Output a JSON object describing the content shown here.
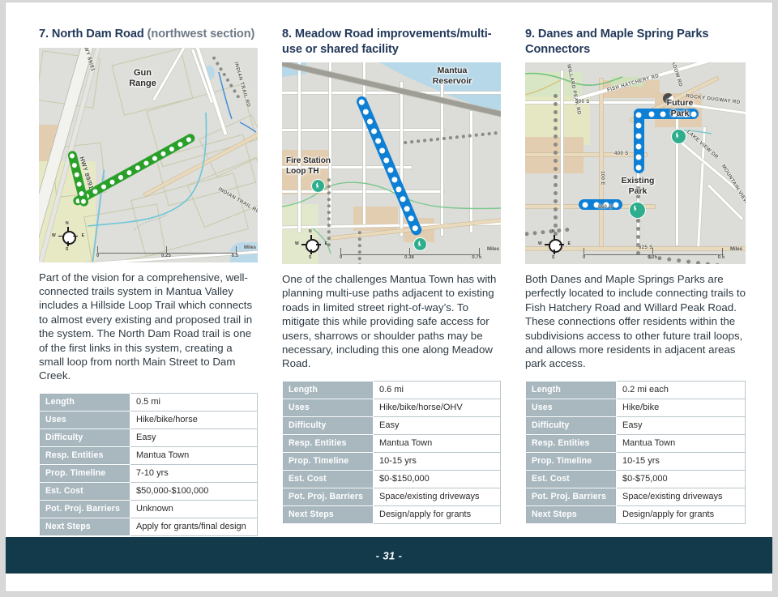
{
  "page": {
    "number_label": "- 31 -",
    "footer_color": "#123a4b",
    "table_header_color": "#a9b8bf",
    "heading_color": "#23395b"
  },
  "table_keys": [
    "Length",
    "Uses",
    "Difficulty",
    "Resp. Entities",
    "Prop. Timeline",
    "Est. Cost",
    "Pot. Proj. Barriers",
    "Next Steps"
  ],
  "sections": [
    {
      "number_title": "7. North Dam Road ",
      "subtitle": "(northwest section)",
      "description": "Part of the vision for a comprehensive, well-connected trails system in Mantua Valley includes a Hillside Loop Trail which connects to almost every existing and proposed trail in the system. The North Dam Road trail is one of the first links in this system, creating a small loop from north Main Street to Dam Creek.",
      "table": {
        "length": "0.5 mi",
        "uses": "Hike/bike/horse",
        "difficulty": "Easy",
        "resp_entities": "Mantua Town",
        "prop_timeline": "7-10 yrs",
        "est_cost": "$50,000-$100,000",
        "pot_proj_barriers": "Unknown",
        "next_steps": "Apply for grants/final design"
      },
      "map": {
        "trail_color": "#2aa02a",
        "labels": [
          "Gun Range"
        ],
        "road_labels": [
          "HWY 89/91",
          "HWY 89/91",
          "INDIAN TRAIL RD",
          "INDIAN TRAIL RD"
        ],
        "scale": {
          "min": "0",
          "mid": "0.25",
          "max": "0.5",
          "unit": "Miles"
        },
        "compass": {
          "n": "N",
          "s": "S",
          "e": "E",
          "w": "W"
        }
      }
    },
    {
      "number_title": "8. Meadow Road improvements/multi-use or shared facility",
      "subtitle": "",
      "description": "One of the challenges Mantua Town has with planning multi-use paths adjacent to existing roads in limited street right-of-way’s. To mitigate this while providing safe access for users, sharrows or shoulder paths may be necessary, including this one along Meadow Road.",
      "table": {
        "length": "0.6 mi",
        "uses": "Hike/bike/horse/OHV",
        "difficulty": "Easy",
        "resp_entities": "Mantua Town",
        "prop_timeline": "10-15 yrs",
        "est_cost": "$0-$150,000",
        "pot_proj_barriers": "Space/existing driveways",
        "next_steps": "Design/apply for grants"
      },
      "map": {
        "trail_color": "#0d7fd4",
        "labels": [
          "Mantua Reservoir",
          "Fire Station Loop TH"
        ],
        "road_labels": [],
        "scale": {
          "min": "0",
          "mid": "0.38",
          "max": "0.75",
          "unit": "Miles"
        },
        "compass": {
          "n": "N",
          "s": "S",
          "e": "E",
          "w": "W"
        }
      }
    },
    {
      "number_title": "9. Danes and Maple Spring Parks Connectors",
      "subtitle": "",
      "description": "Both Danes and Maple Springs Parks are perfectly located to include connecting trails to Fish Hatchery Road and Willard Peak Road. These connections offer residents within the subdivisions access to other future trail loops, and allows more residents in adjacent areas park access.",
      "table": {
        "length": "0.2 mi each",
        "uses": "Hike/bike",
        "difficulty": "Easy",
        "resp_entities": "Mantua Town",
        "prop_timeline": "10-15 yrs",
        "est_cost": "$0-$75,000",
        "pot_proj_barriers": "Space/existing driveways",
        "next_steps": "Design/apply for grants"
      },
      "map": {
        "trail_color": "#0d7fd4",
        "labels": [
          "Future Park",
          "Existing Park"
        ],
        "road_labels": [
          "FISH HATCHERY RD",
          "WILLARD PEAK RD",
          "MEADOW RD",
          "ROCKY DUGWAY RD",
          "LAKE VIEW DR",
          "MOUNTAIN VIEW DR",
          "300 S",
          "400 S",
          "550 S",
          "625 S",
          "100 E"
        ],
        "scale": {
          "min": "0",
          "mid": "0.25",
          "max": "0.5",
          "unit": "Miles"
        },
        "compass": {
          "n": "N",
          "s": "S",
          "e": "E",
          "w": "W"
        }
      }
    }
  ]
}
